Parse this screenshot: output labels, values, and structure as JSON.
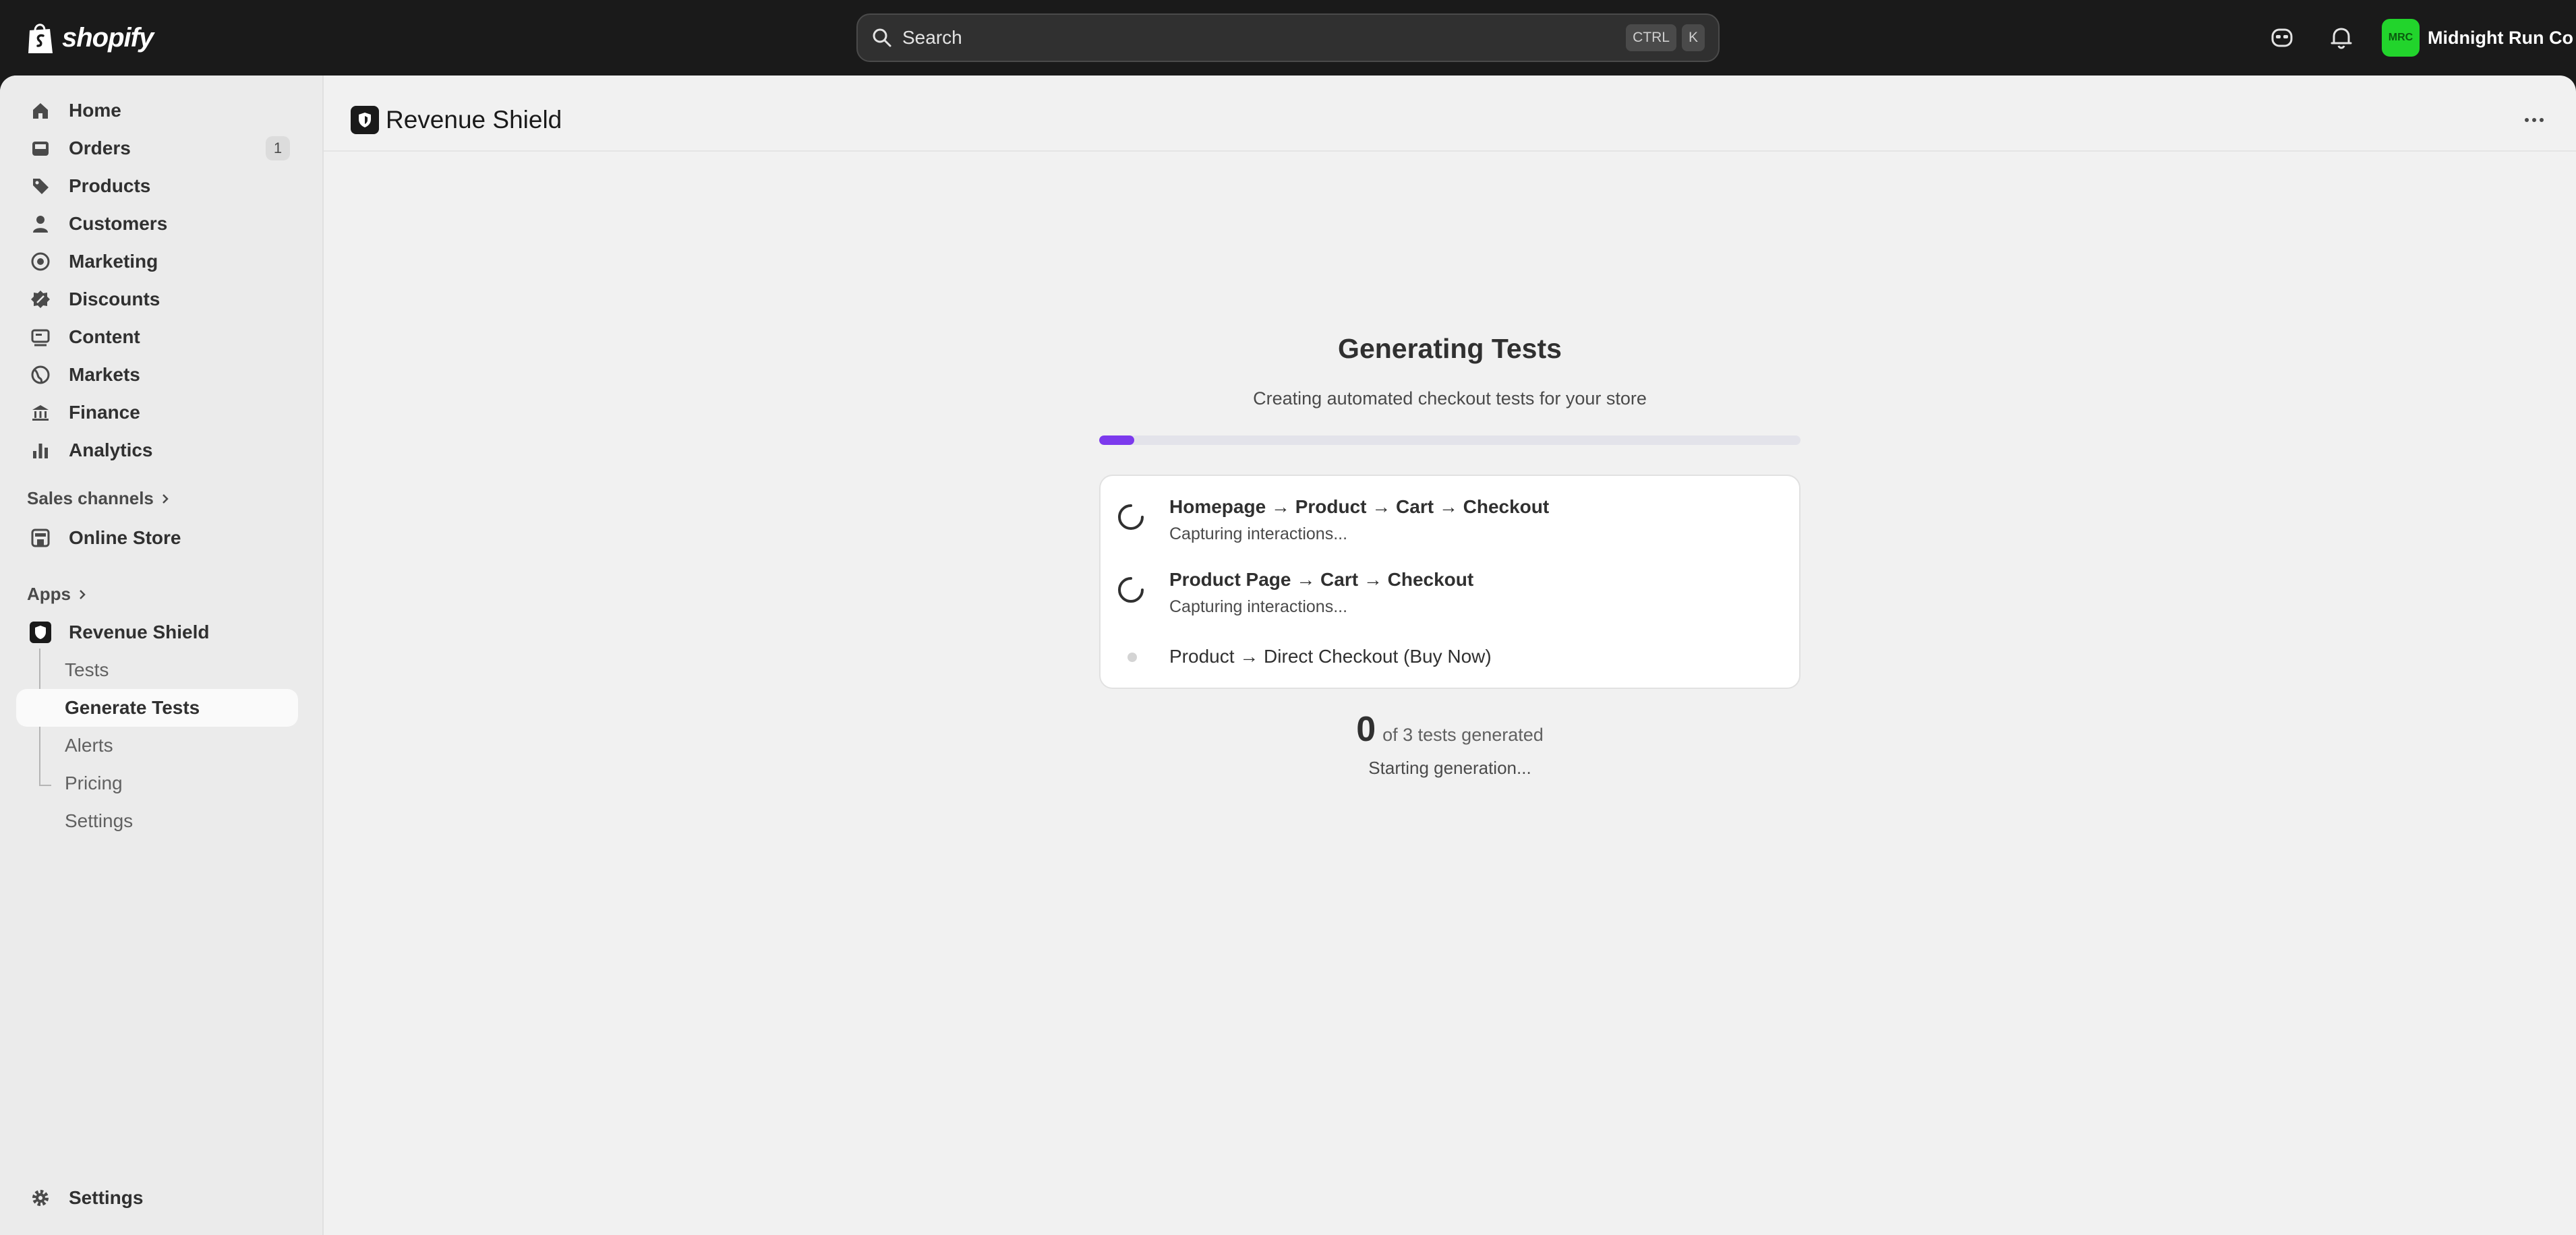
{
  "topbar": {
    "brand": "shopify",
    "search_placeholder": "Search",
    "shortcut_keys": [
      "CTRL",
      "K"
    ],
    "account": {
      "initials": "MRC",
      "name": "Midnight Run Co",
      "avatar_color": "#22d42c"
    }
  },
  "sidebar": {
    "items": [
      {
        "label": "Home",
        "icon": "home-icon"
      },
      {
        "label": "Orders",
        "icon": "orders-icon",
        "badge": "1"
      },
      {
        "label": "Products",
        "icon": "tag-icon"
      },
      {
        "label": "Customers",
        "icon": "person-icon"
      },
      {
        "label": "Marketing",
        "icon": "target-icon"
      },
      {
        "label": "Discounts",
        "icon": "discount-icon"
      },
      {
        "label": "Content",
        "icon": "content-icon"
      },
      {
        "label": "Markets",
        "icon": "globe-icon"
      },
      {
        "label": "Finance",
        "icon": "bank-icon"
      },
      {
        "label": "Analytics",
        "icon": "chart-icon"
      }
    ],
    "sales_channels_label": "Sales channels",
    "online_store_label": "Online Store",
    "apps_label": "Apps",
    "app_name": "Revenue Shield",
    "app_subitems": [
      "Tests",
      "Generate Tests",
      "Alerts",
      "Pricing",
      "Settings"
    ],
    "active_subitem": "Generate Tests",
    "settings_label": "Settings"
  },
  "page": {
    "title": "Revenue Shield",
    "heading": "Generating Tests",
    "subheading": "Creating automated checkout tests for your store",
    "progress_fraction": 0.05,
    "accent_color": "#7c3aed",
    "tests": [
      {
        "name": "Homepage → Product → Cart → Checkout",
        "status": "Capturing interactions...",
        "state": "running"
      },
      {
        "name": "Product Page → Cart → Checkout",
        "status": "Capturing interactions...",
        "state": "running"
      },
      {
        "name": "Product → Direct Checkout (Buy Now)",
        "status": "",
        "state": "pending"
      }
    ],
    "generated_count": "0",
    "generated_text": "of 3 tests generated",
    "generation_status": "Starting generation..."
  }
}
